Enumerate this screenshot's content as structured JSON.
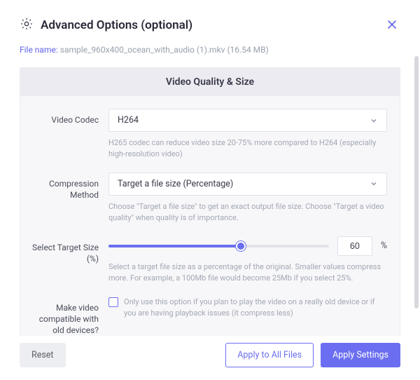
{
  "header": {
    "title": "Advanced Options (optional)"
  },
  "file": {
    "label": "File name:",
    "name": "sample_960x400_ocean_with_audio (1).mkv",
    "size": "(16.54 MB)"
  },
  "section": {
    "title": "Video Quality & Size"
  },
  "codec": {
    "label": "Video Codec",
    "value": "H264",
    "help": "H265 codec can reduce video size 20-75% more compared to H264 (especially high-resolution video)"
  },
  "compression": {
    "label": "Compression Method",
    "value": "Target a file size (Percentage)",
    "help": "Choose \"Target a file size\" to get an exact output file size. Choose \"Target a video quality\" when quality is of importance."
  },
  "target": {
    "label": "Select Target Size (%)",
    "value": "60",
    "suffix": "%",
    "help": "Select a target file size as a percentage of the original. Smaller values compress more. For example, a 100Mb file would become 25Mb if you select 25%."
  },
  "compat": {
    "label": "Make video compatible with old devices?",
    "help": "Only use this option if you plan to play the video on a really old device or if you are having playback issues (it compress less)"
  },
  "footer": {
    "reset": "Reset",
    "apply_all": "Apply to All Files",
    "apply": "Apply Settings"
  },
  "colors": {
    "accent": "#6b6ef0"
  }
}
